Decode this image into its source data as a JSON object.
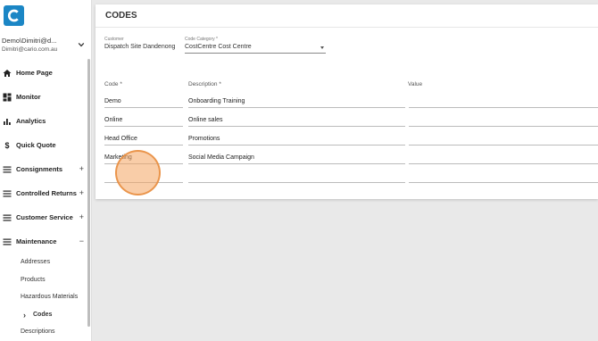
{
  "app": {
    "logo_letter": "C"
  },
  "user": {
    "name": "Demo\\Dimitri@d...",
    "email": "Dimitri@cario.com.au"
  },
  "nav": {
    "items": [
      {
        "label": "Home Page",
        "icon": "home-icon",
        "expandable": false
      },
      {
        "label": "Monitor",
        "icon": "dashboard-icon",
        "expandable": false
      },
      {
        "label": "Analytics",
        "icon": "bar-chart-icon",
        "expandable": false
      },
      {
        "label": "Quick Quote",
        "icon": "dollar-icon",
        "expandable": false
      },
      {
        "label": "Consignments",
        "icon": "menu-icon",
        "expandable": true,
        "toggle": "+"
      },
      {
        "label": "Controlled Returns",
        "icon": "menu-icon",
        "expandable": true,
        "toggle": "+"
      },
      {
        "label": "Customer Service",
        "icon": "menu-icon",
        "expandable": true,
        "toggle": "+"
      },
      {
        "label": "Maintenance",
        "icon": "menu-icon",
        "expandable": true,
        "toggle": "−"
      }
    ],
    "maintenance_sub": [
      {
        "label": "Addresses"
      },
      {
        "label": "Products"
      },
      {
        "label": "Hazardous Materials"
      },
      {
        "label": "Codes",
        "active": true,
        "caret": "›"
      },
      {
        "label": "Descriptions"
      }
    ]
  },
  "page": {
    "title": "CODES"
  },
  "filters": {
    "customer": {
      "label": "Customer",
      "value": "Dispatch Site Dandenong"
    },
    "category": {
      "label": "Code Category *",
      "value": "CostCentre Cost Centre"
    }
  },
  "table": {
    "headers": {
      "code": "Code *",
      "description": "Description *",
      "value": "Value"
    },
    "rows": [
      {
        "code": "Demo",
        "description": "Onboarding Training",
        "value": ""
      },
      {
        "code": "Online",
        "description": "Online sales",
        "value": ""
      },
      {
        "code": "Head Office",
        "description": "Promotions",
        "value": ""
      },
      {
        "code": "Marketing",
        "description": "Social Media Campaign",
        "value": ""
      },
      {
        "code": "",
        "description": "",
        "value": ""
      }
    ]
  },
  "colors": {
    "brand": "#1b86c5",
    "click_indicator": "#f4a460"
  }
}
